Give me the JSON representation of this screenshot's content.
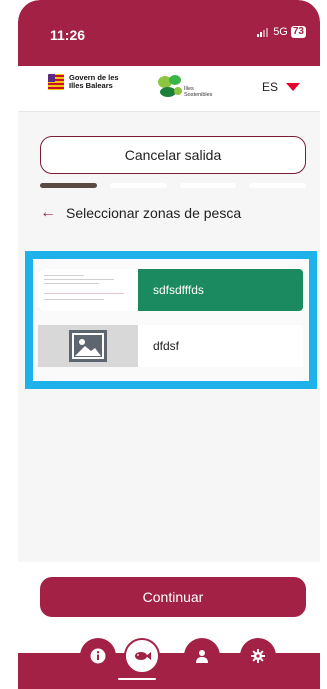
{
  "status_bar": {
    "time": "11:26",
    "network": "5G",
    "battery": "73"
  },
  "header": {
    "govern_line1": "Govern de les",
    "govern_line2": "Illes Balears",
    "illes_line1": "Illes",
    "illes_line2": "Sostenibles",
    "language": "ES"
  },
  "cancel_button": "Cancelar salida",
  "progress": {
    "steps": 4,
    "current": 1
  },
  "page_title": "Seleccionar zonas de pesca",
  "zones": [
    {
      "label": "sdfsdfffds",
      "selected": true,
      "thumbnail": "document-preview"
    },
    {
      "label": "dfdsf",
      "selected": false,
      "thumbnail": "image-placeholder-icon"
    }
  ],
  "continue_button": "Continuar",
  "nav": [
    {
      "name": "info-icon",
      "active": false
    },
    {
      "name": "fish-icon",
      "active": true
    },
    {
      "name": "user-icon",
      "active": false
    },
    {
      "name": "settings-icon",
      "active": false
    }
  ],
  "colors": {
    "primary": "#a32145",
    "selected_zone": "#1b8a61",
    "highlight": "#1eb1ea",
    "language_arrow": "#e4002b"
  }
}
